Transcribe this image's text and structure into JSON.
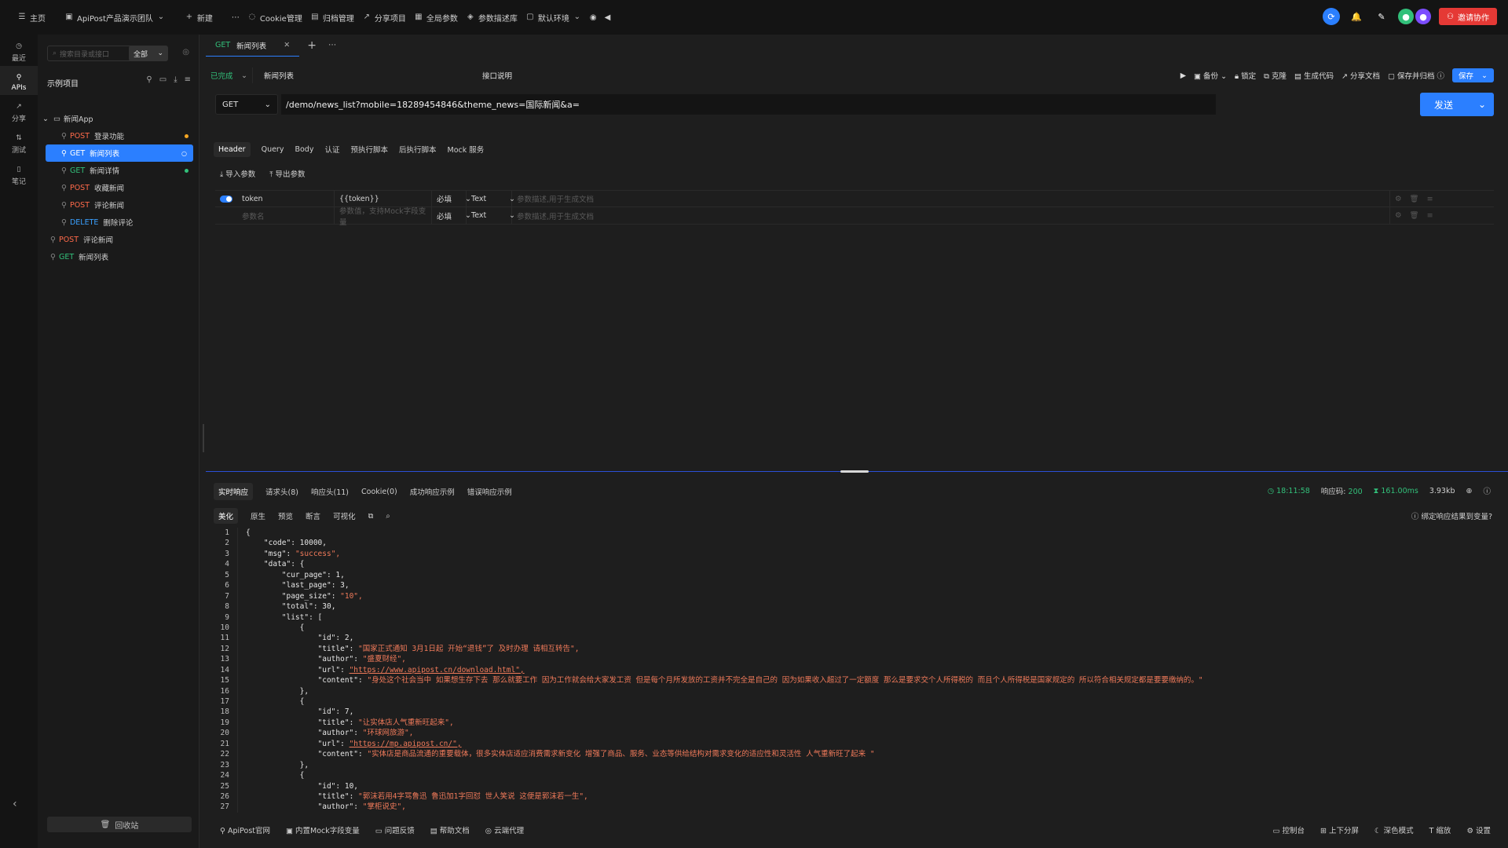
{
  "topbar": {
    "home": "主页",
    "team": "ApiPost产品演示团队",
    "new": "新建",
    "cookie": "Cookie管理",
    "archive": "归档管理",
    "share": "分享项目",
    "global_params": "全局参数",
    "param_desc": "参数描述库",
    "env": "默认环境",
    "invite": "邀请协作"
  },
  "rail": [
    {
      "label": "最近",
      "icon": "clock-icon"
    },
    {
      "label": "APIs",
      "icon": "link-icon"
    },
    {
      "label": "分享",
      "icon": "share-icon"
    },
    {
      "label": "测试",
      "icon": "swap-icon"
    },
    {
      "label": "笔记",
      "icon": "note-icon"
    }
  ],
  "sidebar": {
    "search_placeholder": "搜索目录或接口",
    "scope": "全部",
    "project_title": "示例项目",
    "tree": [
      {
        "type": "folder",
        "label": "新闻App"
      },
      {
        "method": "POST",
        "label": "登录功能",
        "dot": "#f5a623"
      },
      {
        "method": "GET",
        "label": "新闻列表",
        "selected": true
      },
      {
        "method": "GET",
        "label": "新闻详情",
        "dot": "#32c07a"
      },
      {
        "method": "POST",
        "label": "收藏新闻"
      },
      {
        "method": "POST",
        "label": "评论新闻"
      },
      {
        "method": "DELETE",
        "label": "删除评论"
      },
      {
        "method": "POST",
        "label": "评论新闻",
        "root": true
      },
      {
        "method": "GET",
        "label": "新闻列表",
        "root": true
      }
    ],
    "recycle": "回收站"
  },
  "tab": {
    "method": "GET",
    "title": "新闻列表"
  },
  "toolbar": {
    "status": "已完成",
    "name": "新闻列表",
    "desc": "接口说明",
    "backup": "备份",
    "lock": "锁定",
    "clone": "克隆",
    "gen_code": "生成代码",
    "share_doc": "分享文档",
    "save_archive": "保存并归档",
    "save": "保存"
  },
  "request": {
    "method": "GET",
    "url": "/demo/news_list?mobile=18289454846&theme_news=国际新闻&a=",
    "send": "发送"
  },
  "req_tabs": [
    "Header",
    "Query",
    "Body",
    "认证",
    "预执行脚本",
    "后执行脚本",
    "Mock 服务"
  ],
  "import": "导入参数",
  "export": "导出参数",
  "params": [
    {
      "name": "token",
      "value": "{{token}}",
      "required": "必填",
      "type": "Text",
      "desc": "参数描述,用于生成文档",
      "enabled": true
    },
    {
      "name": "参数名",
      "value": "参数值，支持Mock字段变量",
      "required": "必填",
      "type": "Text",
      "desc": "参数描述,用于生成文档",
      "placeholder": true
    }
  ],
  "resp_tabs": [
    "实时响应",
    "请求头(8)",
    "响应头(11)",
    "Cookie(0)",
    "成功响应示例",
    "错误响应示例"
  ],
  "resp_meta": {
    "time": "18:11:58",
    "code_label": "响应码:",
    "code": "200",
    "duration": "161.00ms",
    "size": "3.93kb"
  },
  "view_tabs": [
    "美化",
    "原生",
    "预览",
    "断言",
    "可视化"
  ],
  "bind_var": "绑定响应结果到变量?",
  "code_lines": [
    "{",
    "    \"code\": 10000,",
    "    \"msg\": \"success\",",
    "    \"data\": {",
    "        \"cur_page\": 1,",
    "        \"last_page\": 3,",
    "        \"page_size\": \"10\",",
    "        \"total\": 30,",
    "        \"list\": [",
    "            {",
    "                \"id\": 2,",
    "                \"title\": \"国家正式通知 3月1日起 开始“退钱”了 及时办理 请相互转告\",",
    "                \"author\": \"盛夏财经\",",
    "                \"url\": \"https://www.apipost.cn/download.html\",",
    "                \"content\": \"身处这个社会当中 如果想生存下去 那么就要工作 因为工作就会给大家发工资 但是每个月所发放的工资并不完全是自己的 因为如果收入超过了一定额度 那么是要求交个人所得税的 而且个人所得税是国家规定的 所以符合相关规定都是要要缴纳的。\"",
    "            },",
    "            {",
    "                \"id\": 7,",
    "                \"title\": \"让实体店人气重新旺起来\",",
    "                \"author\": \"环球网旅游\",",
    "                \"url\": \"https://mp.apipost.cn/\",",
    "                \"content\": \"实体店是商品流通的重要载体，很多实体店适应消费需求新变化 增强了商品、服务、业态等供给结构对需求变化的适应性和灵活性 人气重新旺了起来 \"",
    "            },",
    "            {",
    "                \"id\": 10,",
    "                \"title\": \"郭沫若用4字骂鲁迅 鲁迅加1字回怼 世人笑说 这便是郭沫若一生\",",
    "                \"author\": \"掌柜说史\","
  ],
  "statusbar": {
    "left": [
      "ApiPost官网",
      "内置Mock字段变量",
      "问题反馈",
      "帮助文档",
      "云端代理"
    ],
    "right": [
      "控制台",
      "上下分屏",
      "深色模式",
      "缩放",
      "设置"
    ]
  }
}
